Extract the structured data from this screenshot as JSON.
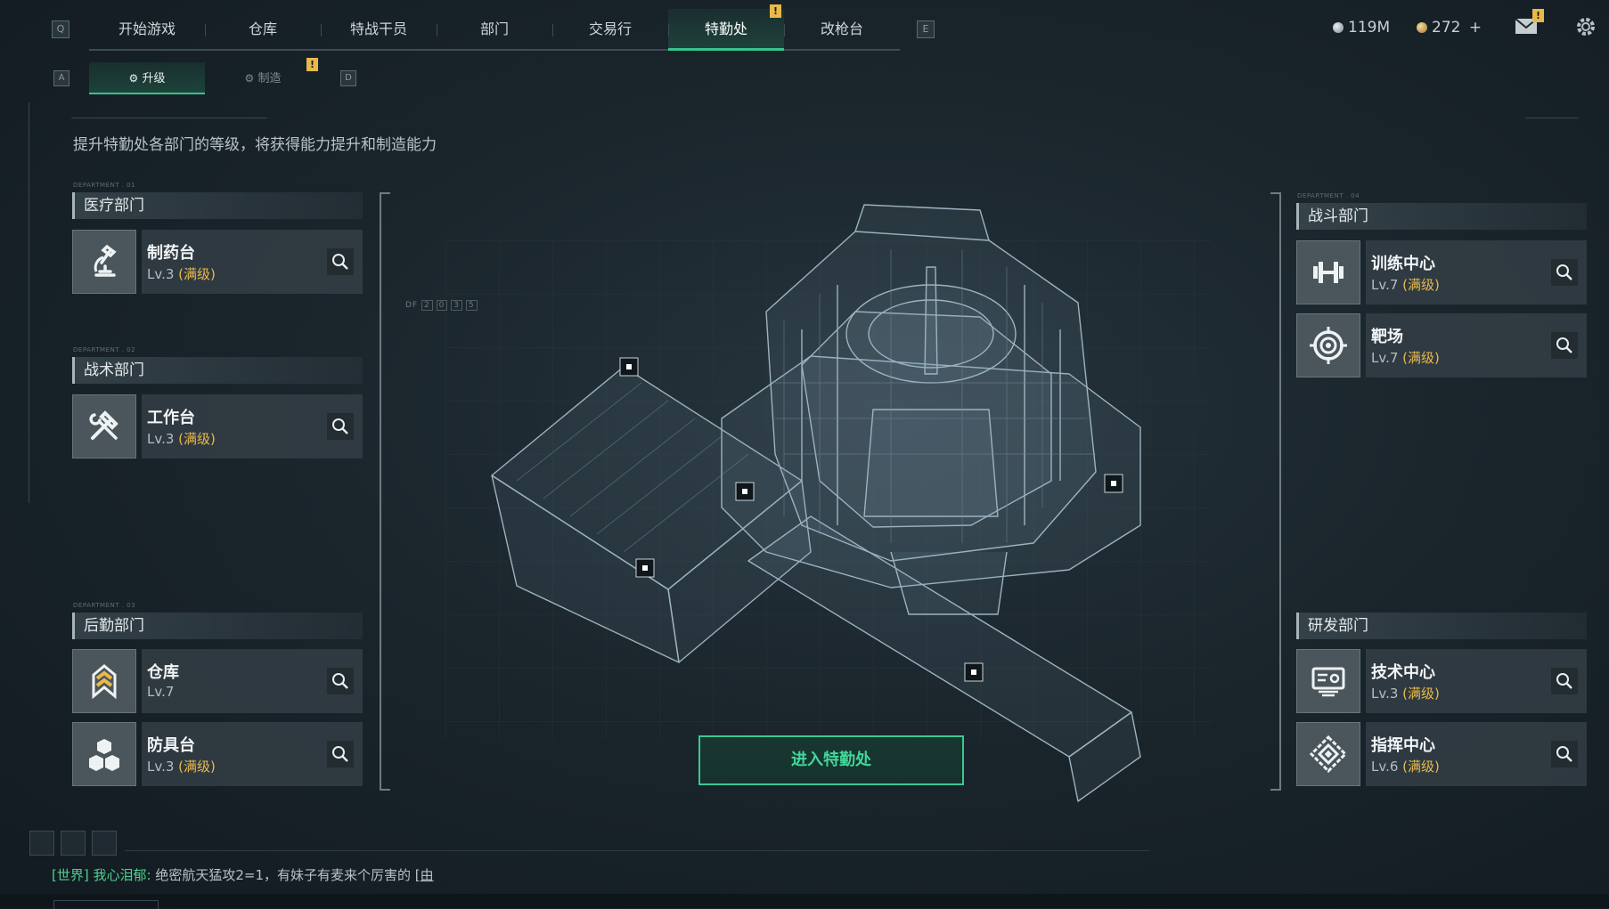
{
  "nav": {
    "key_left": "Q",
    "key_right": "E",
    "tabs": [
      "开始游戏",
      "仓库",
      "特战干员",
      "部门",
      "交易行",
      "特勤处",
      "改枪台"
    ],
    "active_tab": "特勤处",
    "alert_badge": "!"
  },
  "subnav": {
    "key_left": "A",
    "key_right": "D",
    "tabs": [
      "升级",
      "制造"
    ],
    "active": "升级",
    "alert_badge": "!"
  },
  "currency": {
    "silver": "119M",
    "gold": "272",
    "gold_add": "+",
    "mail_badge": "!"
  },
  "description": "提升特勤处各部门的等级，将获得能力提升和制造能力",
  "departments": {
    "medical": {
      "tag": "DEPARTMENT . 01",
      "name": "医疗部门",
      "facilities": [
        {
          "name": "制药台",
          "level": "Lv.3",
          "max": "(满级)",
          "icon": "microscope-icon"
        }
      ]
    },
    "tactical": {
      "tag": "DEPARTMENT . 02",
      "name": "战术部门",
      "facilities": [
        {
          "name": "工作台",
          "level": "Lv.3",
          "max": "(满级)",
          "icon": "hammer-wrench-icon"
        }
      ]
    },
    "logistics": {
      "tag": "DEPARTMENT . 03",
      "name": "后勤部门",
      "facilities": [
        {
          "name": "仓库",
          "level": "Lv.7",
          "max": "",
          "icon": "chevron-rank-icon"
        },
        {
          "name": "防具台",
          "level": "Lv.3",
          "max": "(满级)",
          "icon": "armor-blocks-icon"
        }
      ]
    },
    "combat": {
      "tag": "DEPARTMENT . 04",
      "name": "战斗部门",
      "facilities": [
        {
          "name": "训练中心",
          "level": "Lv.7",
          "max": "(满级)",
          "icon": "dumbbell-icon"
        },
        {
          "name": "靶场",
          "level": "Lv.7",
          "max": "(满级)",
          "icon": "target-icon"
        }
      ]
    },
    "research": {
      "name": "研发部门",
      "facilities": [
        {
          "name": "技术中心",
          "level": "Lv.3",
          "max": "(满级)",
          "icon": "tech-panel-icon"
        },
        {
          "name": "指挥中心",
          "level": "Lv.6",
          "max": "(满级)",
          "icon": "command-diamond-icon"
        }
      ]
    }
  },
  "enter_button": "进入特勤处",
  "hud": {
    "df_label": "DF",
    "df_digits": [
      "2",
      "0",
      "3",
      "5"
    ]
  },
  "chat": {
    "channel": "[世界]",
    "sender": "我心泪郁:",
    "message": "绝密航天猛攻2=1，有妹子有麦来个厉害的",
    "link": "[由"
  }
}
